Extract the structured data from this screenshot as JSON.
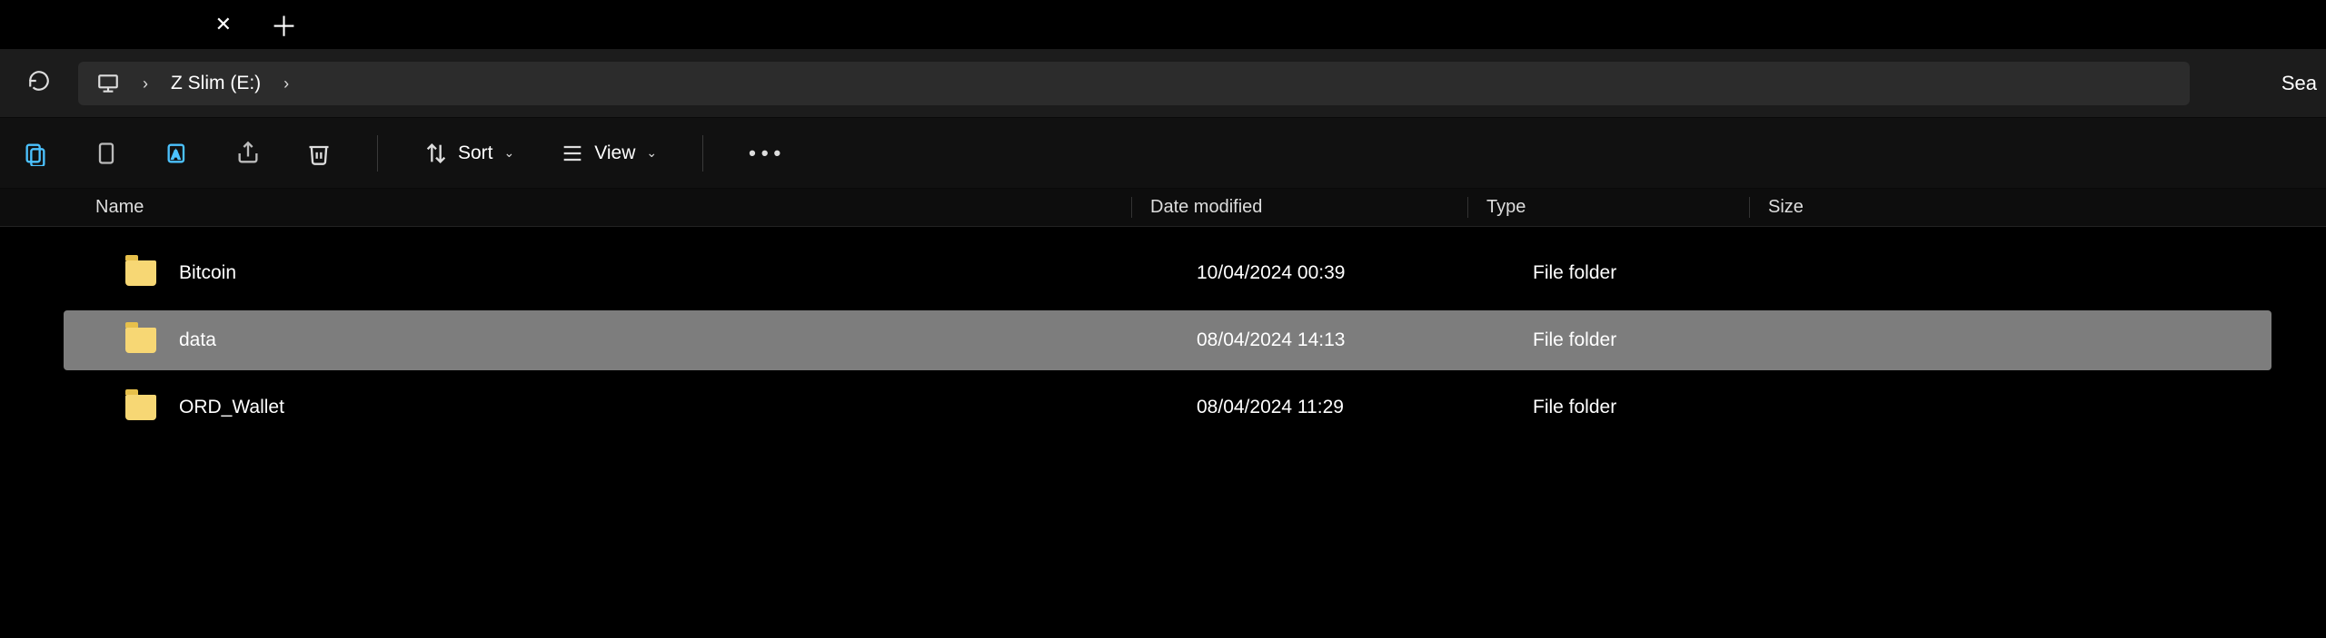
{
  "tab": {
    "title": ""
  },
  "breadcrumb": {
    "root": "",
    "drive": "Z Slim (E:)",
    "search_hint": "Sea"
  },
  "toolbar": {
    "sort": "Sort",
    "view": "View"
  },
  "columns": {
    "name": "Name",
    "date": "Date modified",
    "type": "Type",
    "size": "Size"
  },
  "files": [
    {
      "name": "Bitcoin",
      "date": "10/04/2024 00:39",
      "type": "File folder",
      "size": "",
      "selected": false
    },
    {
      "name": "data",
      "date": "08/04/2024 14:13",
      "type": "File folder",
      "size": "",
      "selected": true
    },
    {
      "name": "ORD_Wallet",
      "date": "08/04/2024 11:29",
      "type": "File folder",
      "size": "",
      "selected": false
    }
  ]
}
